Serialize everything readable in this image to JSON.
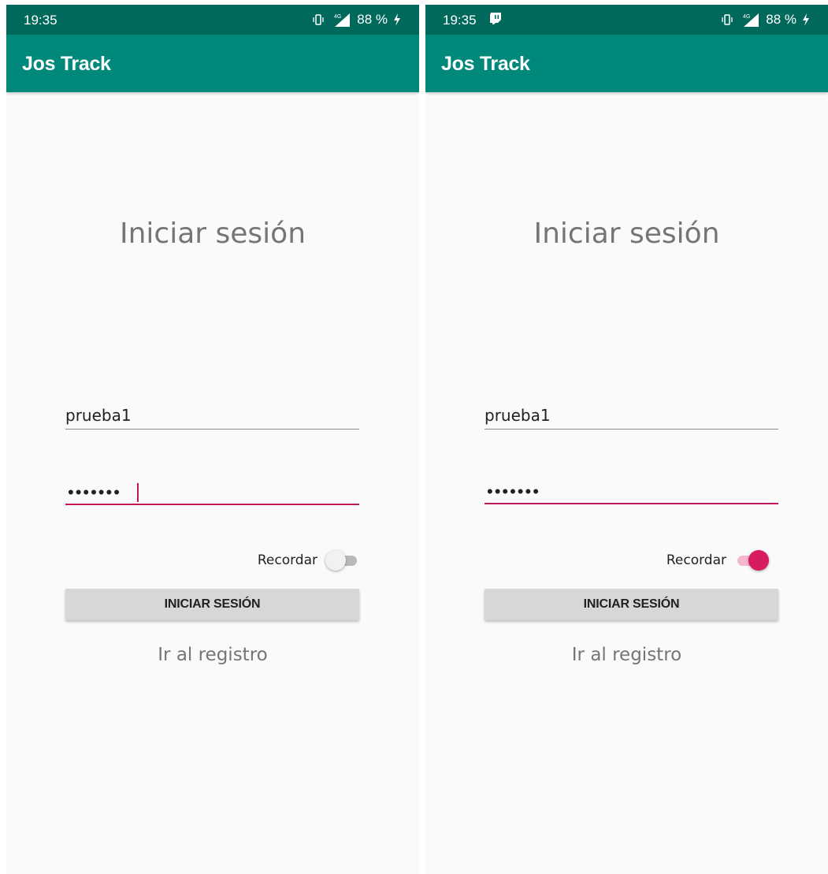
{
  "colors": {
    "status_bar": "#00695c",
    "app_bar": "#00897b",
    "accent": "#d81b60",
    "background": "#fafafa",
    "button": "#d6d7d7"
  },
  "screens": [
    {
      "status": {
        "time": "19:35",
        "network": "4G",
        "battery": "88 %",
        "icons": [
          "vibrate-icon",
          "signal-icon",
          "charging-icon"
        ]
      },
      "app_title": "Jos Track",
      "heading": "Iniciar sesión",
      "username_value": "prueba1",
      "password_dots": "•••••••",
      "password_focused": true,
      "remember_label": "Recordar",
      "remember_on": false,
      "login_button": "INICIAR SESIÓN",
      "register_link": "Ir al registro"
    },
    {
      "status": {
        "time": "19:35",
        "network": "4G",
        "battery": "88 %",
        "notification_icon": "twitch-icon",
        "icons": [
          "vibrate-icon",
          "signal-icon",
          "charging-icon"
        ]
      },
      "app_title": "Jos Track",
      "heading": "Iniciar sesión",
      "username_value": "prueba1",
      "password_dots": "•••••••",
      "password_focused": false,
      "remember_label": "Recordar",
      "remember_on": true,
      "login_button": "INICIAR SESIÓN",
      "register_link": "Ir al registro"
    }
  ]
}
